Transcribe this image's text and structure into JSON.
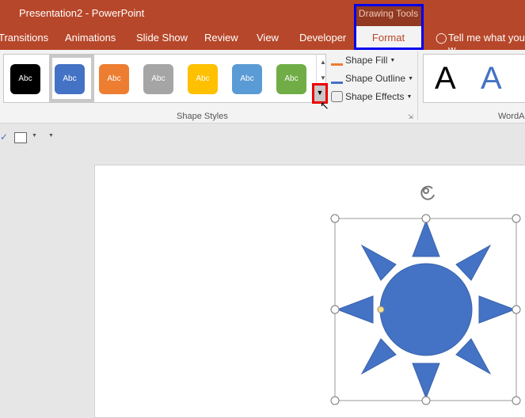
{
  "window": {
    "title": "Presentation2  -  PowerPoint",
    "context_header": "Drawing Tools"
  },
  "tabs": [
    "Transitions",
    "Animations",
    "Slide Show",
    "Review",
    "View",
    "Developer",
    "Format"
  ],
  "tell_me": "Tell me what you w",
  "shape_styles": {
    "swatches": [
      {
        "label": "Abc",
        "color": "#000000"
      },
      {
        "label": "Abc",
        "color": "#4472c4"
      },
      {
        "label": "Abc",
        "color": "#ed7d31"
      },
      {
        "label": "Abc",
        "color": "#a5a5a5"
      },
      {
        "label": "Abc",
        "color": "#ffc000"
      },
      {
        "label": "Abc",
        "color": "#5b9bd5"
      },
      {
        "label": "Abc",
        "color": "#70ad47"
      }
    ],
    "group_label": "Shape Styles",
    "fill": "Shape Fill",
    "outline": "Shape Outline",
    "effects": "Shape Effects"
  },
  "wordart": {
    "letters": [
      "A",
      "A"
    ],
    "group_label": "WordA"
  },
  "colors": {
    "accent": "#b7472a",
    "shape": "#4472c4"
  }
}
